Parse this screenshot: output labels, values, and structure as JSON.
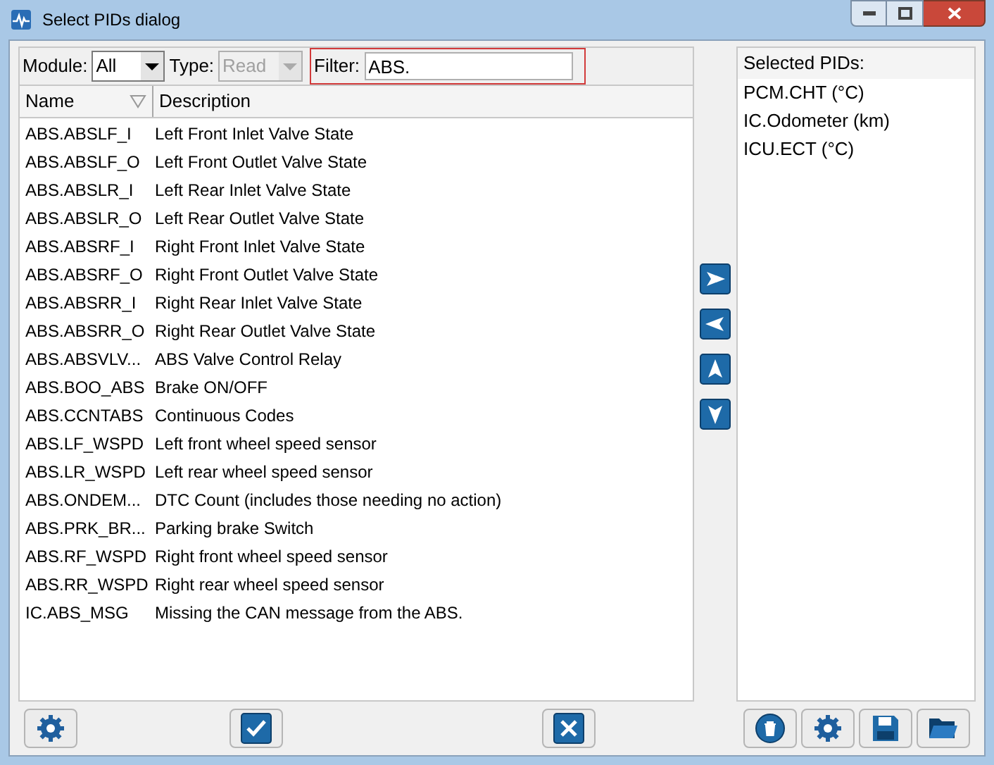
{
  "window": {
    "title": "Select PIDs dialog"
  },
  "module": {
    "label": "Module:",
    "value": "All",
    "disabled": false
  },
  "type": {
    "label": "Type:",
    "value": "Read",
    "disabled": true
  },
  "filter": {
    "label": "Filter:",
    "value": "ABS."
  },
  "columns": [
    "Name",
    "Description"
  ],
  "rows": [
    {
      "name": "ABS.ABSLF_I",
      "description": "Left Front Inlet Valve State"
    },
    {
      "name": "ABS.ABSLF_O",
      "description": "Left Front Outlet Valve State"
    },
    {
      "name": "ABS.ABSLR_I",
      "description": "Left Rear Inlet Valve State"
    },
    {
      "name": "ABS.ABSLR_O",
      "description": "Left Rear Outlet Valve State"
    },
    {
      "name": "ABS.ABSRF_I",
      "description": "Right Front Inlet Valve State"
    },
    {
      "name": "ABS.ABSRF_O",
      "description": "Right Front Outlet Valve State"
    },
    {
      "name": "ABS.ABSRR_I",
      "description": "Right Rear Inlet Valve State"
    },
    {
      "name": "ABS.ABSRR_O",
      "description": "Right Rear Outlet Valve State"
    },
    {
      "name": "ABS.ABSVLV...",
      "description": "ABS Valve Control Relay"
    },
    {
      "name": "ABS.BOO_ABS",
      "description": "Brake ON/OFF"
    },
    {
      "name": "ABS.CCNTABS",
      "description": "Continuous Codes"
    },
    {
      "name": "ABS.LF_WSPD",
      "description": "Left front wheel speed sensor"
    },
    {
      "name": "ABS.LR_WSPD",
      "description": "Left rear wheel speed sensor"
    },
    {
      "name": "ABS.ONDEM...",
      "description": "DTC Count (includes those needing no action)"
    },
    {
      "name": "ABS.PRK_BR...",
      "description": "Parking brake Switch"
    },
    {
      "name": "ABS.RF_WSPD",
      "description": "Right front wheel speed sensor"
    },
    {
      "name": "ABS.RR_WSPD",
      "description": "Right rear wheel speed sensor"
    },
    {
      "name": "IC.ABS_MSG",
      "description": "Missing the CAN message from the ABS."
    }
  ],
  "selected_pids": {
    "title": "Selected PIDs:",
    "items": [
      "PCM.CHT (°C)",
      "IC.Odometer (km)",
      "ICU.ECT (°C)"
    ]
  }
}
